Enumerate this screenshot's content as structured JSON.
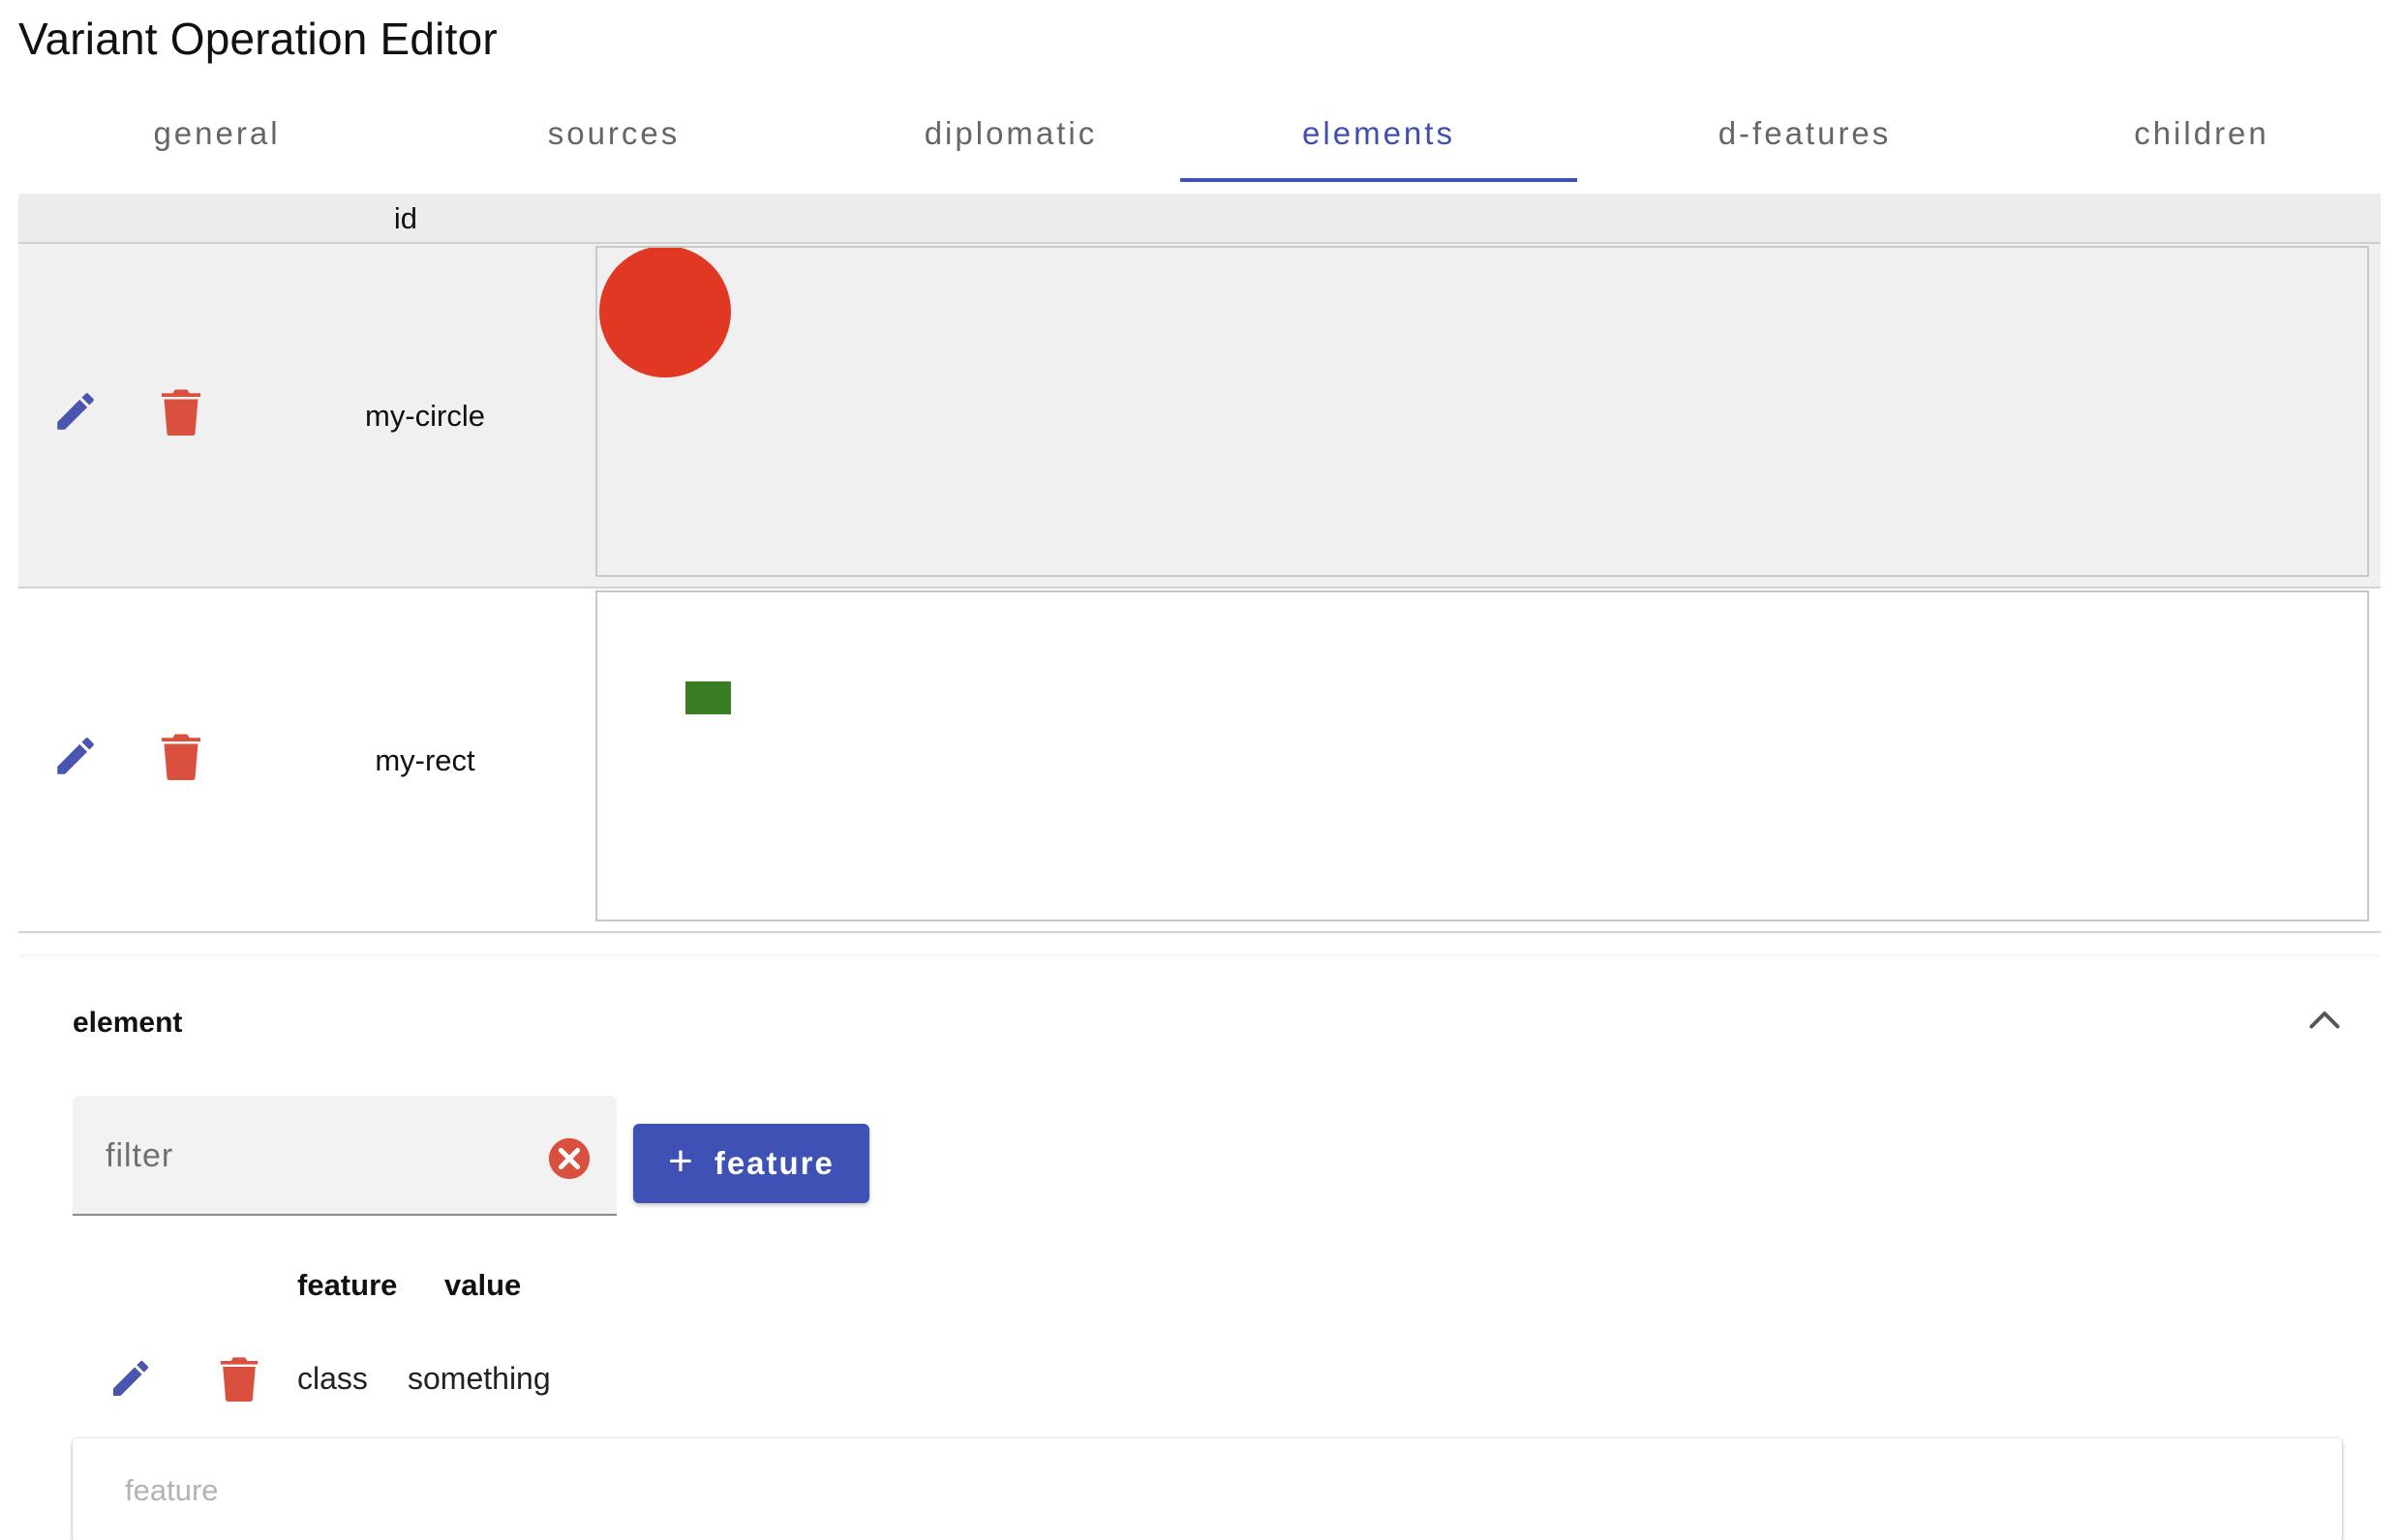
{
  "app": {
    "title": "Variant Operation Editor"
  },
  "tabs": [
    {
      "label": "general"
    },
    {
      "label": "sources"
    },
    {
      "label": "diplomatic"
    },
    {
      "label": "elements",
      "active": true
    },
    {
      "label": "d-features"
    },
    {
      "label": "children"
    }
  ],
  "elements_table": {
    "columns": {
      "id": "id"
    },
    "rows": [
      {
        "id": "my-circle",
        "selected": true,
        "preview": {
          "shape": "circle",
          "color": "#e03822"
        }
      },
      {
        "id": "my-rect",
        "selected": false,
        "preview": {
          "shape": "rect",
          "color": "#3a7d23"
        }
      }
    ]
  },
  "element_panel": {
    "title": "element",
    "filter": {
      "placeholder": "filter",
      "value": ""
    },
    "add_button": {
      "icon": "plus-icon",
      "label": "feature"
    },
    "features_table": {
      "columns": {
        "feature": "feature",
        "value": "value"
      },
      "rows": [
        {
          "feature": "class",
          "value": "something"
        }
      ]
    },
    "feature_input": {
      "placeholder": "feature",
      "value": ""
    }
  },
  "colors": {
    "accent": "#3f51b5",
    "edit_icon": "#4a55b0",
    "delete_icon": "#d9503f",
    "clear_icon": "#d9503f"
  }
}
